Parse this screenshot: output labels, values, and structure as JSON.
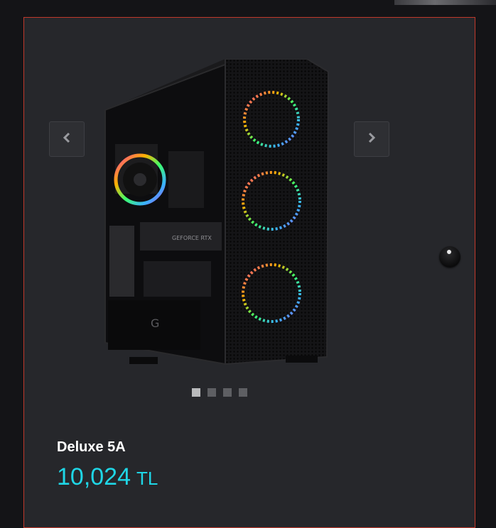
{
  "product": {
    "name": "Deluxe 5A",
    "price": "10,024",
    "currency": "TL"
  },
  "gallery": {
    "image_alt": "Gaming PC case with RGB fans",
    "slide_count": 4,
    "active_slide": 1
  },
  "icons": {
    "prev": "chevron-left-icon",
    "next": "chevron-right-icon"
  },
  "colors": {
    "card_background": "#26272b",
    "card_border": "#c0392b",
    "price": "#1fd6e6",
    "name": "#ffffff"
  }
}
